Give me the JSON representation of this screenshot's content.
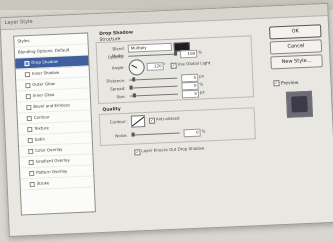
{
  "window": {
    "title": "Layer Style"
  },
  "sidebar": {
    "items": [
      {
        "label": "Styles",
        "sub": false,
        "check": false,
        "active": false
      },
      {
        "label": "Blending Options: Default",
        "sub": false,
        "check": false,
        "active": false
      },
      {
        "label": "Drop Shadow",
        "sub": true,
        "check": true,
        "active": true
      },
      {
        "label": "Inner Shadow",
        "sub": true,
        "check": true,
        "active": false
      },
      {
        "label": "Outer Glow",
        "sub": true,
        "check": true,
        "active": false
      },
      {
        "label": "Inner Glow",
        "sub": true,
        "check": true,
        "active": false
      },
      {
        "label": "Bevel and Emboss",
        "sub": true,
        "check": true,
        "active": false
      },
      {
        "label": "Contour",
        "sub": true,
        "check": true,
        "active": false
      },
      {
        "label": "Texture",
        "sub": true,
        "check": true,
        "active": false
      },
      {
        "label": "Satin",
        "sub": true,
        "check": true,
        "active": false
      },
      {
        "label": "Color Overlay",
        "sub": true,
        "check": true,
        "active": false
      },
      {
        "label": "Gradient Overlay",
        "sub": true,
        "check": true,
        "active": false
      },
      {
        "label": "Pattern Overlay",
        "sub": true,
        "check": true,
        "active": false
      },
      {
        "label": "Stroke",
        "sub": true,
        "check": true,
        "active": false
      }
    ]
  },
  "panel": {
    "title": "Drop Shadow",
    "structure_title": "Structure",
    "blend_mode_label": "Blend Mode:",
    "blend_mode_value": "Multiply",
    "opacity_label": "Opacity:",
    "opacity_value": "100",
    "opacity_unit": "%",
    "angle_label": "Angle:",
    "angle_value": "120",
    "angle_unit": "°",
    "global_light_label": "Use Global Light",
    "distance_label": "Distance:",
    "distance_value": "5",
    "distance_unit": "px",
    "spread_label": "Spread:",
    "spread_value": "0",
    "spread_unit": "%",
    "size_label": "Size:",
    "size_value": "5",
    "size_unit": "px",
    "quality_title": "Quality",
    "contour_label": "Contour:",
    "antialiased_label": "Anti-aliased",
    "noise_label": "Noise:",
    "noise_value": "0",
    "noise_unit": "%",
    "knockout_label": "Layer Knocks Out Drop Shadow",
    "shadow_color": "#1e1e1e"
  },
  "buttons": {
    "ok": "OK",
    "cancel": "Cancel",
    "new_style": "New Style...",
    "preview": "Preview"
  }
}
